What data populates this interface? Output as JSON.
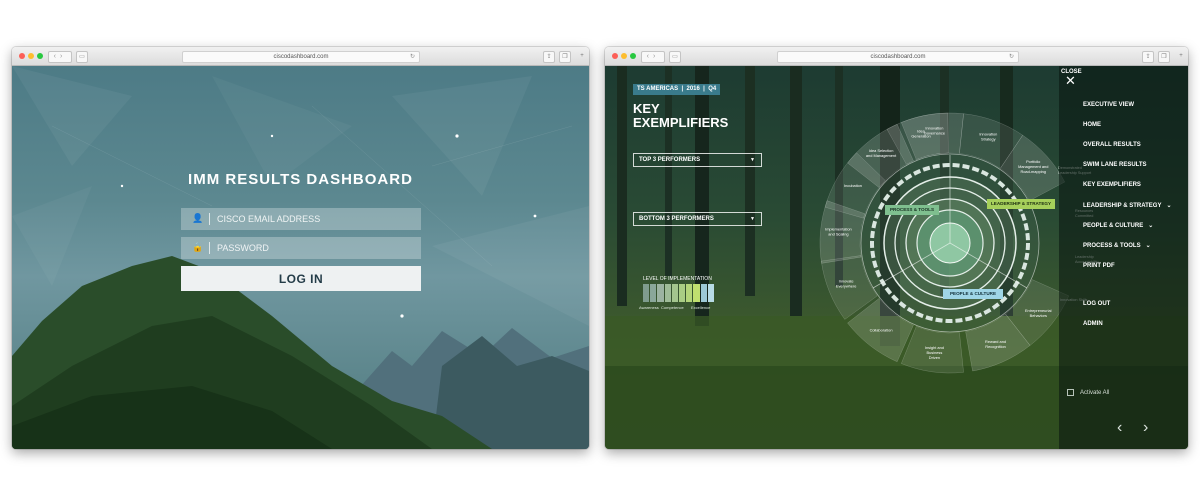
{
  "login_window": {
    "url": "ciscodashboard.com",
    "title": "IMM RESULTS DASHBOARD",
    "email_placeholder": "CISCO EMAIL ADDRESS",
    "password_placeholder": "PASSWORD",
    "login_label": "LOG IN"
  },
  "dashboard_window": {
    "url": "ciscodashboard.com",
    "filter": {
      "region": "TS AMERICAS",
      "year": "2016",
      "quarter": "Q4"
    },
    "title_line1": "KEY",
    "title_line2": "EXEMPLIFIERS",
    "top_dropdown": "TOP 3 PERFORMERS",
    "bottom_dropdown": "BOTTOM 3 PERFORMERS",
    "level_label": "LEVEL OF IMPLEMENTATION",
    "level_ticks": [
      "Awareness",
      "Competence",
      "Excellence"
    ],
    "level_colors": [
      "#7f9c8e",
      "#8aa79a",
      "#9cb3a2",
      "#9fbc98",
      "#a3c58e",
      "#a9cd84",
      "#b3d57a",
      "#bfdf6f",
      "#9cc8d6",
      "#b8dbe6"
    ],
    "wheel": {
      "outer_labels": [
        "Innovation Governance",
        "Innovation Strategy",
        "Portfolio Management and Road-mapping",
        "Entrepreneurial Behaviors",
        "Reward and Recognition",
        "Insight and Business Driven",
        "Collaboration",
        "Innovate Everywhere",
        "Implementation and Scaling",
        "Incubation",
        "Idea Selection and Management",
        "Idea Generation"
      ],
      "side_labels": [
        "Demonstrated Leadership Support",
        "Resources Committed",
        "Leadership Accountability",
        "Innovation Skills"
      ],
      "pillars": [
        "PROCESS & TOOLS",
        "LEADERSHIP & STRATEGY",
        "PEOPLE & CULTURE"
      ]
    },
    "menu": {
      "close_label": "CLOSE",
      "items": [
        "EXECUTIVE VIEW",
        "HOME",
        "OVERALL RESULTS",
        "SWIM LANE RESULTS",
        "KEY EXEMPLIFIERS",
        "LEADERSHIP & STRATEGY",
        "PEOPLE & CULTURE",
        "PROCESS & TOOLS",
        "PRINT PDF",
        "LOG OUT",
        "ADMIN"
      ],
      "activate_label": "Activate All"
    },
    "colors": {
      "accent_blue": "#3a7b8c",
      "accent_green": "#a6d05b",
      "tab_green": "#7fbf8f",
      "tab_blue": "#9fd5e6"
    }
  }
}
